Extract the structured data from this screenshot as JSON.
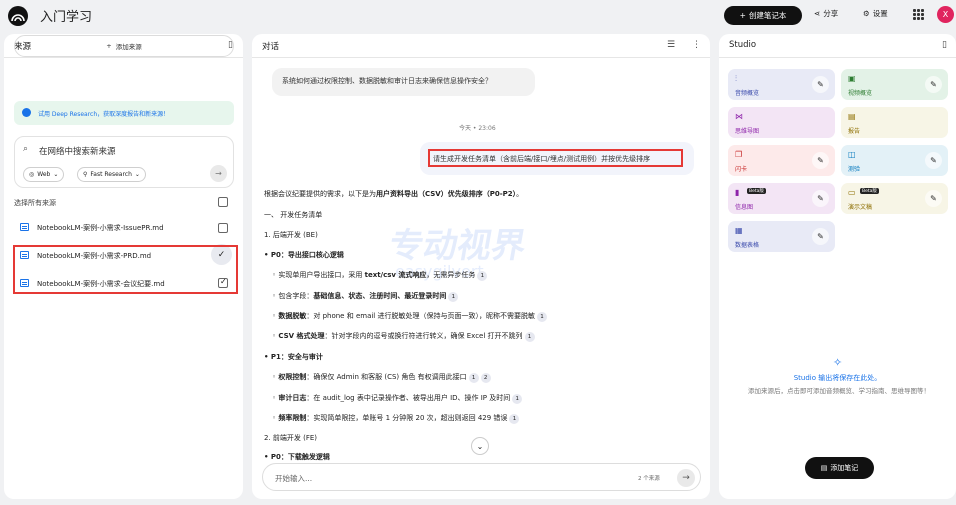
{
  "header": {
    "title": "入门学习",
    "create_label": "创建笔记本",
    "share_label": "分享",
    "settings_label": "设置",
    "avatar_letter": "X"
  },
  "sources": {
    "title": "来源",
    "add_label": "添加来源",
    "deep_research": "试用 Deep Research，获取深度报告和新来源！",
    "search_placeholder": "在网络中搜索新来源",
    "chip_web": "Web",
    "chip_fast": "Fast Research",
    "select_all": "选择所有来源",
    "items": [
      {
        "label": "NotebookLM-案例-小需求-IssuePR.md",
        "checked": false
      },
      {
        "label": "NotebookLM-案例-小需求-PRD.md",
        "checked": true
      },
      {
        "label": "NotebookLM-案例-小需求-会议纪要.md",
        "checked": true
      }
    ]
  },
  "chat": {
    "title": "对话",
    "user_msg_1": "系统如何通过权限控制、数据脱敏和审计日志来确保信息操作安全？",
    "timestamp": "今天 • 23:06",
    "user_msg_2": "请生成开发任务清单（含前后端/接口/埋点/测试用例）并按优先级排序",
    "answer": {
      "intro_pre": "根据会议纪要提供的需求，以下是为",
      "intro_bold": "用户资料导出（CSV）优先级排序（P0-P2）",
      "intro_post": "。",
      "sec1": "一、 开发任务清单",
      "sec1_1": "1. 后端开发 (BE)",
      "p0_title": "• P0：导出接口核心逻辑",
      "p0_items": [
        {
          "pre": "◦ 实现单用户导出接口，采用 ",
          "bold": "text/csv 流式响应",
          "post": "，无需异步任务",
          "refs": [
            "1"
          ]
        },
        {
          "pre": "◦ 包含字段：",
          "bold": "基础信息、状态、注册时间、最近登录时间",
          "post": "",
          "refs": [
            "1"
          ]
        },
        {
          "pre": "◦ ",
          "bold": "数据脱敏",
          "post": "：对 phone 和 email 进行脱敏处理（保持与页面一致），昵称不需要脱敏",
          "refs": [
            "1"
          ]
        },
        {
          "pre": "◦ ",
          "bold": "CSV 格式处理",
          "post": "：针对字段内的逗号或换行符进行转义，确保 Excel 打开不跳列",
          "refs": [
            "1"
          ]
        }
      ],
      "p1_title": "• P1：安全与审计",
      "p1_items": [
        {
          "pre": "◦ ",
          "bold": "权限控制",
          "post": "：确保仅 Admin 和客服 (CS) 角色 有权调用此接口",
          "refs": [
            "1",
            "2"
          ]
        },
        {
          "pre": "◦ ",
          "bold": "审计日志",
          "post": "：在 audit_log 表中记录操作者、被导出用户 ID、操作 IP 及时间",
          "refs": [
            "1"
          ]
        },
        {
          "pre": "◦ ",
          "bold": "频率限制",
          "post": "：实现简单限控，单账号 1 分钟限 20 次，超出则返回 429 错误",
          "refs": [
            "1"
          ]
        }
      ],
      "sec1_2": "2. 前端开发 (FE)",
      "fe_p0": "• P0：下载触发逻辑"
    },
    "input_placeholder": "开始输入...",
    "source_count": "2 个来源"
  },
  "studio": {
    "title": "Studio",
    "cards": [
      {
        "label": "音频概览",
        "icon": "audio-icon",
        "bg": "#e8eaf6",
        "color": "#3949ab",
        "editable": true
      },
      {
        "label": "视频概览",
        "icon": "video-icon",
        "bg": "#e3f2e7",
        "color": "#2e7d32",
        "editable": true
      },
      {
        "label": "思维导图",
        "icon": "mindmap-icon",
        "bg": "#f3e5f5",
        "color": "#8e24aa",
        "editable": false
      },
      {
        "label": "报告",
        "icon": "report-icon",
        "bg": "#f7f5e6",
        "color": "#8d6e00",
        "editable": false
      },
      {
        "label": "闪卡",
        "icon": "flashcard-icon",
        "bg": "#fdeaea",
        "color": "#c62828",
        "editable": true
      },
      {
        "label": "测验",
        "icon": "quiz-icon",
        "bg": "#e3f1f7",
        "color": "#0277bd",
        "editable": true
      },
      {
        "label": "信息图",
        "icon": "infographic-icon",
        "bg": "#f3e5f5",
        "color": "#8e24aa",
        "editable": true,
        "beta": "Beta版"
      },
      {
        "label": "演示文稿",
        "icon": "slides-icon",
        "bg": "#f7f5e6",
        "color": "#8d6e00",
        "editable": true,
        "beta": "Beta版"
      },
      {
        "label": "数据表格",
        "icon": "table-icon",
        "bg": "#e8eaf6",
        "color": "#3949ab",
        "editable": true
      }
    ],
    "empty_title": "Studio 输出将保存在此处。",
    "empty_desc": "添加来源后，点击即可添加音频概览、学习指南、思维导图等！",
    "add_note": "添加笔记"
  }
}
